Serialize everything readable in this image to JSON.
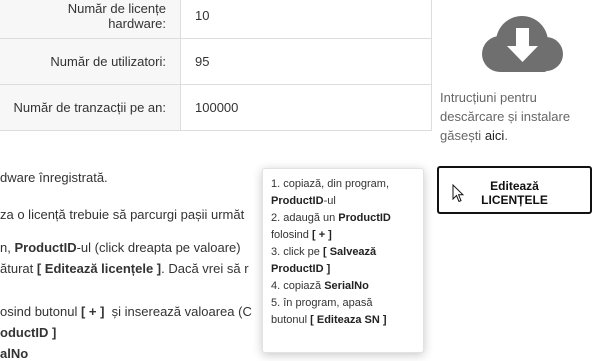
{
  "license_table": {
    "rows": [
      {
        "label": "Număr de licențe hardware:",
        "value": "10"
      },
      {
        "label": "Număr de utilizatori:",
        "value": "95"
      },
      {
        "label": "Număr de tranzacții pe an:",
        "value": "100000"
      }
    ]
  },
  "download": {
    "icon": "cloud-download-icon",
    "note_prefix": "Intrucțiuni pentru descărcare și instalare găsești ",
    "note_link": "aici",
    "note_suffix": "."
  },
  "edit_button": {
    "line1": "Editează",
    "line2": "LICENȚELE"
  },
  "body_text": {
    "line1": "dware înregistrată.",
    "line2": "za o licență trebuie să parcurgi pașii următ",
    "line3_a": "n, ",
    "line3_b": "ProductID",
    "line3_c": "-ul (click dreapta pe valoare)",
    "line4_a": "ăturat ",
    "line4_b": "[ Editează licențele ]",
    "line4_c": ". Dacă vrei să r",
    "line5_a": "osind butonul ",
    "line5_b": "[ + ]",
    "line5_c": "  și inserează valoarea (C",
    "line6": "oductID ]",
    "line7": "alNo"
  },
  "tooltip": {
    "s1_a": "1. copiază, din program,",
    "s1_b": "ProductID",
    "s1_c": "-ul",
    "s2_a": "2. adaugă un ",
    "s2_b": "ProductID",
    "s2_c": "folosind ",
    "s2_d": "[ + ]",
    "s3_a": "3. click pe ",
    "s3_b": "[ Salvează",
    "s3_c": "ProductID ]",
    "s4_a": "4. copiază ",
    "s4_b": "SerialNo",
    "s5_a": "5. în program, apasă",
    "s5_b": "butonul ",
    "s5_c": "[ Editeaza SN ]"
  },
  "colors": {
    "icon_gray": "#6f6f6f",
    "button_border": "#111111"
  }
}
